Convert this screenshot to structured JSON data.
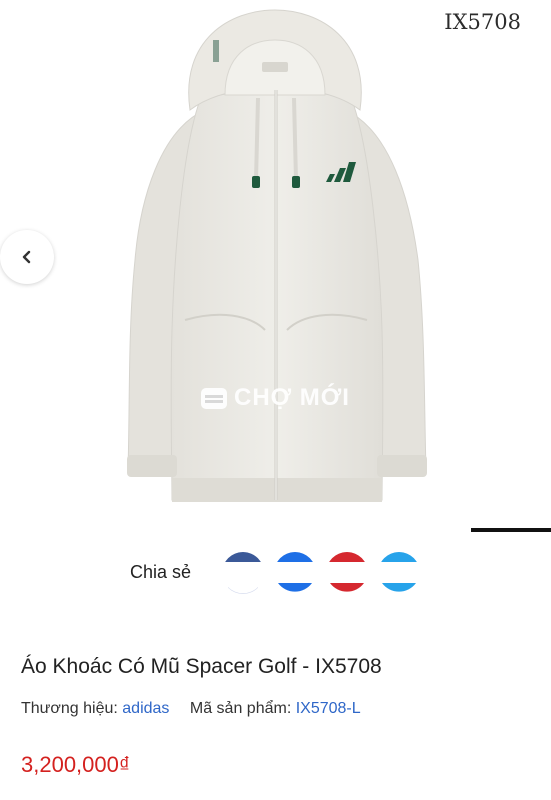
{
  "gallery": {
    "sku_overlay": "IX5708",
    "watermark": "CHỢ MỚI",
    "prev_icon": "chevron-left-icon"
  },
  "share": {
    "label": "Chia sẻ",
    "buttons": [
      {
        "name": "facebook",
        "color": "#3b5998"
      },
      {
        "name": "messenger",
        "color": "#1e6fe6"
      },
      {
        "name": "pinterest",
        "color": "#d5282f"
      },
      {
        "name": "twitter",
        "color": "#27a3ea"
      }
    ]
  },
  "product": {
    "title": "Áo Khoác Có Mũ Spacer Golf - IX5708",
    "brand_label": "Thương hiệu:",
    "brand_value": "adidas",
    "sku_label": "Mã sản phẩm:",
    "sku_value": "IX5708-L",
    "price": "3,200,000₫"
  }
}
